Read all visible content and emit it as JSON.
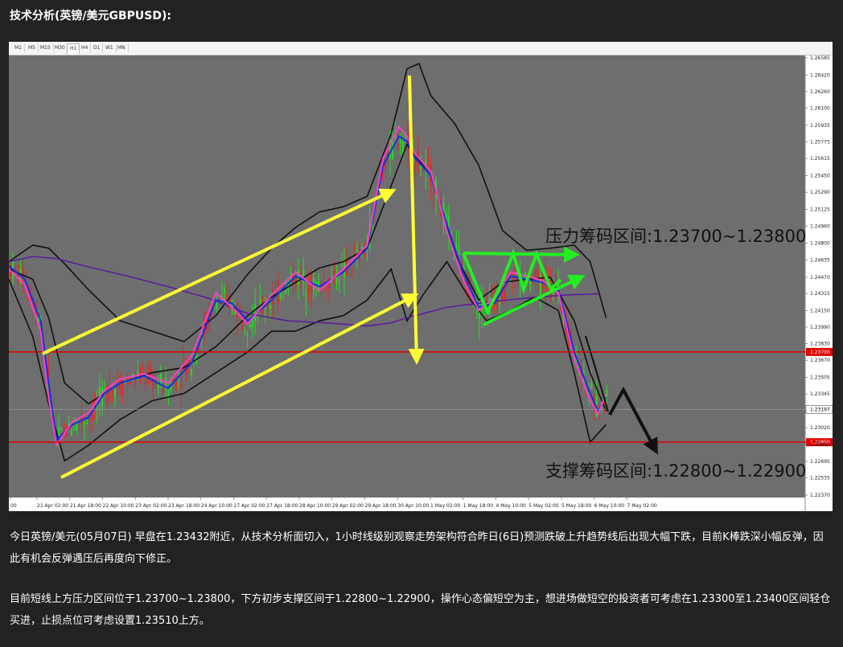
{
  "heading": "技术分析(英镑/美元GBPUSD):",
  "toolbar": {
    "timeframes": [
      "M1",
      "M5",
      "M15",
      "M30",
      "H1",
      "H4",
      "D1",
      "W1",
      "MN"
    ],
    "active": "H1"
  },
  "paragraphs": [
    "今日英镑/美元(05月07日) 早盘在1.23432附近，从技术分析面切入，1小时线级别观察走势架构符合昨日(6日)预测跌破上升趋势线后出现大幅下跌，目前K棒跌深小幅反弹，因此有机会反弹遇压后再度向下修正。",
    "目前短线上方压力区间位于1.23700~1.23800，下方初步支撑区间于1.22800~1.22900，操作心态偏短空为主，想进场做短空的投资者可考虑在1.23300至1.23400区间轻仓买进，止损点位可考虑设置1.23510上方。"
  ],
  "chart_data": {
    "type": "line",
    "symbol": "GBPUSD",
    "timeframe": "H1",
    "ylim": [
      1.2237,
      1.26585
    ],
    "y_ticks": [
      1.26585,
      1.2642,
      1.2626,
      1.261,
      1.25935,
      1.25775,
      1.25615,
      1.2545,
      1.2529,
      1.25125,
      1.2496,
      1.248,
      1.24635,
      1.2447,
      1.24315,
      1.2415,
      1.2399,
      1.2383,
      1.2367,
      1.23505,
      1.23345,
      1.2318,
      1.2302,
      1.2286,
      1.22695,
      1.22535,
      1.2237
    ],
    "x_labels": [
      "00",
      "21 Apr 02:00",
      "21 Apr 18:00",
      "22 Apr 10:00",
      "23 Apr 02:00",
      "23 Apr 18:00",
      "24 Apr 10:00",
      "27 Apr 02:00",
      "27 Apr 18:00",
      "28 Apr 10:00",
      "29 Apr 02:00",
      "29 Apr 18:00",
      "30 Apr 10:00",
      "1 May 02:00",
      "1 May 18:00",
      "4 May 10:00",
      "5 May 02:00",
      "5 May 18:00",
      "6 May 10:00",
      "7 May 02:00"
    ],
    "current_price_label": "1.23197",
    "current_price": 1.23197,
    "horizontal_lines": [
      {
        "value": 1.2375,
        "color": "#e00000",
        "label": "1.23700"
      },
      {
        "value": 1.2288,
        "color": "#e00000",
        "label": "1.22850"
      }
    ],
    "annotations": [
      {
        "text": "压力筹码区间:1.23700~1.23800"
      },
      {
        "text": "支撑筹码区间:1.22800~1.22900"
      }
    ],
    "series": [
      {
        "color": "#111111",
        "style": "bollinger-upper",
        "x": [
          0,
          0.03,
          0.05,
          0.07,
          0.1,
          0.14,
          0.18,
          0.22,
          0.26,
          0.3,
          0.33,
          0.36,
          0.39,
          0.42,
          0.45,
          0.48,
          0.5,
          0.515,
          0.53,
          0.56,
          0.59,
          0.62,
          0.65,
          0.68,
          0.71,
          0.73,
          0.75
        ],
        "y": [
          1.2462,
          1.2478,
          1.2475,
          1.246,
          1.2435,
          1.2405,
          1.2395,
          1.2385,
          1.241,
          1.245,
          1.2475,
          1.2495,
          1.251,
          1.2515,
          1.2525,
          1.2585,
          1.2648,
          1.2653,
          1.2622,
          1.2595,
          1.2555,
          1.2492,
          1.2473,
          1.2475,
          1.2478,
          1.2462,
          1.2408
        ]
      },
      {
        "color": "#111111",
        "style": "bollinger-middle",
        "x": [
          0,
          0.03,
          0.05,
          0.07,
          0.1,
          0.14,
          0.18,
          0.22,
          0.26,
          0.3,
          0.33,
          0.36,
          0.39,
          0.42,
          0.45,
          0.48,
          0.5,
          0.53,
          0.56,
          0.59,
          0.62,
          0.65,
          0.68,
          0.71,
          0.73,
          0.75
        ],
        "y": [
          1.2455,
          1.2445,
          1.2408,
          1.2345,
          1.2325,
          1.2345,
          1.2355,
          1.236,
          1.238,
          1.241,
          1.2428,
          1.2442,
          1.2456,
          1.2462,
          1.2475,
          1.2535,
          1.2575,
          1.2545,
          1.247,
          1.2425,
          1.2442,
          1.2445,
          1.2447,
          1.2405,
          1.2355,
          1.2318
        ]
      },
      {
        "color": "#111111",
        "style": "bollinger-lower",
        "x": [
          0,
          0.03,
          0.05,
          0.07,
          0.1,
          0.14,
          0.18,
          0.22,
          0.26,
          0.3,
          0.33,
          0.36,
          0.39,
          0.42,
          0.45,
          0.48,
          0.5,
          0.52,
          0.55,
          0.58,
          0.6,
          0.63,
          0.66,
          0.69,
          0.71,
          0.73,
          0.75
        ],
        "y": [
          1.2445,
          1.239,
          1.2325,
          1.227,
          1.2285,
          1.231,
          1.2328,
          1.2335,
          1.2355,
          1.2375,
          1.2395,
          1.2395,
          1.2405,
          1.241,
          1.2425,
          1.2455,
          1.2405,
          1.243,
          1.2462,
          1.2425,
          1.2405,
          1.2415,
          1.2428,
          1.2415,
          1.2355,
          1.2288,
          1.2305
        ]
      },
      {
        "color": "#5a1f9a",
        "style": "ma-200",
        "x": [
          0,
          0.03,
          0.06,
          0.1,
          0.15,
          0.2,
          0.25,
          0.3,
          0.35,
          0.4,
          0.45,
          0.48,
          0.5,
          0.55,
          0.6,
          0.65,
          0.7,
          0.74
        ],
        "y": [
          1.2462,
          1.2467,
          1.2465,
          1.2457,
          1.2448,
          1.2438,
          1.2427,
          1.2412,
          1.2405,
          1.2403,
          1.24,
          1.2403,
          1.2408,
          1.2418,
          1.2423,
          1.2427,
          1.243,
          1.2431
        ]
      },
      {
        "color": "#1a2ee0",
        "style": "ema-fast",
        "x": [
          0,
          0.02,
          0.04,
          0.05,
          0.06,
          0.08,
          0.1,
          0.12,
          0.14,
          0.17,
          0.2,
          0.23,
          0.26,
          0.28,
          0.3,
          0.33,
          0.36,
          0.39,
          0.42,
          0.45,
          0.47,
          0.49,
          0.5,
          0.51,
          0.53,
          0.55,
          0.57,
          0.59,
          0.61,
          0.63,
          0.65,
          0.67,
          0.69,
          0.71,
          0.73,
          0.74,
          0.75
        ],
        "y": [
          1.2458,
          1.2445,
          1.2405,
          1.2345,
          1.229,
          1.2305,
          1.2312,
          1.2335,
          1.2345,
          1.2352,
          1.234,
          1.2365,
          1.2425,
          1.2422,
          1.2405,
          1.2425,
          1.2448,
          1.2438,
          1.2452,
          1.2475,
          1.2555,
          1.2583,
          1.2578,
          1.2562,
          1.2545,
          1.2498,
          1.2452,
          1.2418,
          1.2422,
          1.2448,
          1.2445,
          1.2442,
          1.2435,
          1.2375,
          1.2335,
          1.2318,
          1.2332
        ]
      },
      {
        "color": "#ff40c0",
        "style": "ema-slow",
        "x": [
          0,
          0.02,
          0.04,
          0.05,
          0.06,
          0.08,
          0.1,
          0.12,
          0.14,
          0.17,
          0.2,
          0.23,
          0.26,
          0.28,
          0.3,
          0.33,
          0.36,
          0.39,
          0.42,
          0.45,
          0.47,
          0.49,
          0.5,
          0.51,
          0.53,
          0.55,
          0.57,
          0.59,
          0.61,
          0.63,
          0.65,
          0.67,
          0.69,
          0.71,
          0.73,
          0.74,
          0.75
        ],
        "y": [
          1.2455,
          1.244,
          1.2395,
          1.233,
          1.2285,
          1.2308,
          1.2316,
          1.2338,
          1.2349,
          1.2354,
          1.2345,
          1.2372,
          1.2432,
          1.2418,
          1.2402,
          1.243,
          1.2452,
          1.2434,
          1.2455,
          1.2478,
          1.2562,
          1.2592,
          1.2583,
          1.2566,
          1.2549,
          1.2492,
          1.2445,
          1.2415,
          1.2428,
          1.2452,
          1.2448,
          1.2444,
          1.2432,
          1.2368,
          1.2328,
          1.2315,
          1.2335
        ]
      }
    ]
  }
}
